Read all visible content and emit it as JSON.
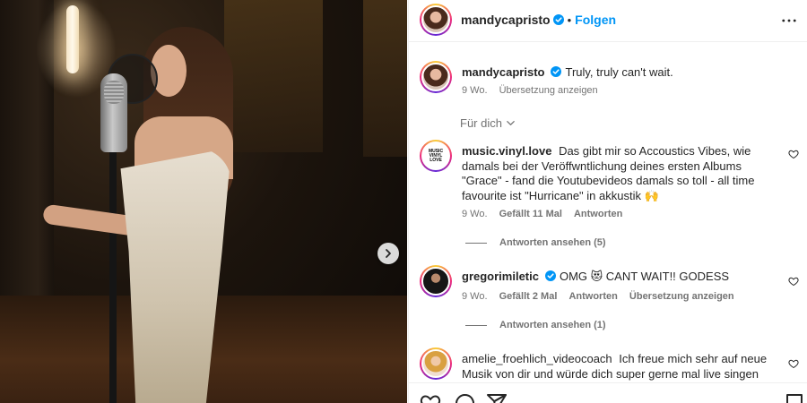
{
  "post": {
    "author": "mandycapristo",
    "follow_label": "Folgen",
    "separator": "•",
    "caption": {
      "text": "Truly, truly can't wait.",
      "time": "9 Wo.",
      "translate": "Übersetzung anzeigen"
    }
  },
  "filter_label": "Für dich",
  "comments": [
    {
      "username": "music.vinyl.love",
      "text": "Das gibt mir so Accoustics Vibes, wie damals bei der Veröffwntlichung deines ersten Albums \"Grace\" - fand die Youtubevideos damals so toll - all time favourite ist \"Hurricane\" in akkustik 🙌",
      "time": "9 Wo.",
      "likes": "Gefällt 11 Mal",
      "reply": "Antworten",
      "view_replies": "Antworten ansehen (5)",
      "avatar_text": "MUSIC VINYL LOVE"
    },
    {
      "username": "gregorimiletic",
      "text": "OMG 😻 CANT WAIT!! GODESS",
      "time": "9 Wo.",
      "likes": "Gefällt 2 Mal",
      "reply": "Antworten",
      "translate": "Übersetzung anzeigen",
      "view_replies": "Antworten ansehen (1)"
    },
    {
      "username": "amelie_froehlich_videocoach",
      "text": "Ich freue mich sehr auf neue Musik von dir und würde dich super gerne mal live singen"
    }
  ],
  "icons": {
    "carousel_next": "chevron-right-icon",
    "more": "more-horizontal-icon",
    "verified": "verified-badge-icon",
    "like": "heart-icon",
    "comment": "comment-icon",
    "share": "share-icon",
    "save": "bookmark-icon"
  },
  "colors": {
    "link_blue": "#0095f6",
    "verified_blue": "#0095f6",
    "muted_text": "#737373",
    "border": "#efefef"
  }
}
